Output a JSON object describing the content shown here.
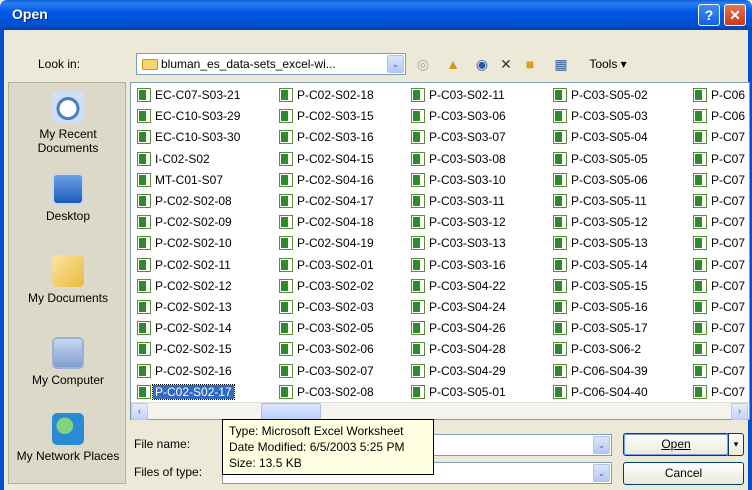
{
  "window": {
    "title": "Open",
    "help_glyph": "?",
    "close_glyph": "✕"
  },
  "lookin": {
    "label": "Look in:",
    "value": "bluman_es_data-sets_excel-wi...",
    "arrow": "⌄"
  },
  "toolbar": {
    "tools_label": "Tools ▾",
    "icons": [
      "back-icon",
      "up-folder-icon",
      "search-web-icon",
      "delete-icon",
      "new-folder-icon",
      "views-icon"
    ]
  },
  "places": [
    {
      "key": "recent",
      "label": "My Recent Documents",
      "icon": "recent-documents-icon"
    },
    {
      "key": "desktop",
      "label": "Desktop",
      "icon": "desktop-icon"
    },
    {
      "key": "docs",
      "label": "My Documents",
      "icon": "my-documents-icon"
    },
    {
      "key": "computer",
      "label": "My Computer",
      "icon": "my-computer-icon"
    },
    {
      "key": "network",
      "label": "My Network Places",
      "icon": "network-places-icon"
    }
  ],
  "files": {
    "col1": [
      "EC-C07-S03-21",
      "EC-C10-S03-29",
      "EC-C10-S03-30",
      "I-C02-S02",
      "MT-C01-S07",
      "P-C02-S02-08",
      "P-C02-S02-09",
      "P-C02-S02-10",
      "P-C02-S02-11",
      "P-C02-S02-12",
      "P-C02-S02-13",
      "P-C02-S02-14",
      "P-C02-S02-15",
      "P-C02-S02-16",
      "P-C02-S02-17"
    ],
    "col2": [
      "P-C02-S02-18",
      "P-C02-S03-15",
      "P-C02-S03-16",
      "P-C02-S04-15",
      "P-C02-S04-16",
      "P-C02-S04-17",
      "P-C02-S04-18",
      "P-C02-S04-19",
      "P-C03-S02-01",
      "P-C03-S02-02",
      "P-C03-S02-03",
      "P-C03-S02-05",
      "P-C03-S02-06",
      "P-C03-S02-07",
      "P-C03-S02-08"
    ],
    "col3": [
      "P-C03-S02-11",
      "P-C03-S03-06",
      "P-C03-S03-07",
      "P-C03-S03-08",
      "P-C03-S03-10",
      "P-C03-S03-11",
      "P-C03-S03-12",
      "P-C03-S03-13",
      "P-C03-S03-16",
      "P-C03-S04-22",
      "P-C03-S04-24",
      "P-C03-S04-26",
      "P-C03-S04-28",
      "P-C03-S04-29",
      "P-C03-S05-01"
    ],
    "col4": [
      "P-C03-S05-02",
      "P-C03-S05-03",
      "P-C03-S05-04",
      "P-C03-S05-05",
      "P-C03-S05-06",
      "P-C03-S05-11",
      "P-C03-S05-12",
      "P-C03-S05-13",
      "P-C03-S05-14",
      "P-C03-S05-15",
      "P-C03-S05-16",
      "P-C03-S05-17",
      "P-C03-S06-2",
      "P-C06-S04-39",
      "P-C06-S04-40"
    ],
    "col5": [
      "P-C06",
      "P-C06",
      "P-C07",
      "P-C07",
      "P-C07",
      "P-C07",
      "P-C07",
      "P-C07",
      "P-C07",
      "P-C07",
      "P-C07",
      "P-C07",
      "P-C07",
      "P-C07",
      "P-C07"
    ],
    "selected": "P-C02-S02-17"
  },
  "scrollbar": {
    "left_glyph": "‹",
    "right_glyph": "›"
  },
  "filename": {
    "label": "File name:",
    "value": ""
  },
  "filetype": {
    "label": "Files of type:",
    "value": ""
  },
  "buttons": {
    "open": "Open",
    "cancel": "Cancel",
    "dropdown_glyph": "▾"
  },
  "tooltip": {
    "line1": "Type: Microsoft Excel Worksheet",
    "line2": "Date Modified: 6/5/2003 5:25 PM",
    "line3": "Size: 13.5 KB"
  }
}
